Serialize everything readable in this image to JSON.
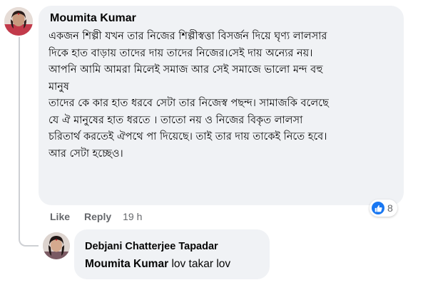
{
  "comment": {
    "author": "Moumita Kumar",
    "lines": [
      "একজন শিল্পী যখন তার নিজের শিল্পীস্বত্তা বিসর্জন দিয়ে ঘৃণ্য লালসার",
      "দিকে হাত বাড়ায় তাদের দায় তাদের নিজের।সেই দায় অন্যের নয়।",
      "আপনি আমি আমরা মিলেই সমাজ আর সেই সমাজে ভালো মন্দ বহু",
      "মানুষ",
      "তাদের কে কার হাত ধরবে সেটা তার নিজেস্ব পছন্দ। সামাজকি বলেছে",
      "যে ঐ মানুষের হাত ধরতে । তাতো নয় ও নিজের বিকৃত লালসা",
      "চরিতার্থ করতেই ঐপথে পা দিয়েছে। তাই তার দায় তাকেই নিতে হবে।",
      "আর সেটা হচ্ছেও।"
    ],
    "actions": {
      "like_label": "Like",
      "reply_label": "Reply",
      "timestamp": "19 h"
    },
    "reaction": {
      "icon": "thumbs-up-icon",
      "color": "#1877f2",
      "count": "8"
    }
  },
  "reply": {
    "author": "Debjani Chatterjee Tapadar",
    "mention": "Moumita Kumar",
    "text": "lov takar lov"
  },
  "colors": {
    "bubble": "#f0f2f5",
    "secondary_text": "#65676b",
    "primary_text": "#050505",
    "like_blue": "#1877f2"
  }
}
